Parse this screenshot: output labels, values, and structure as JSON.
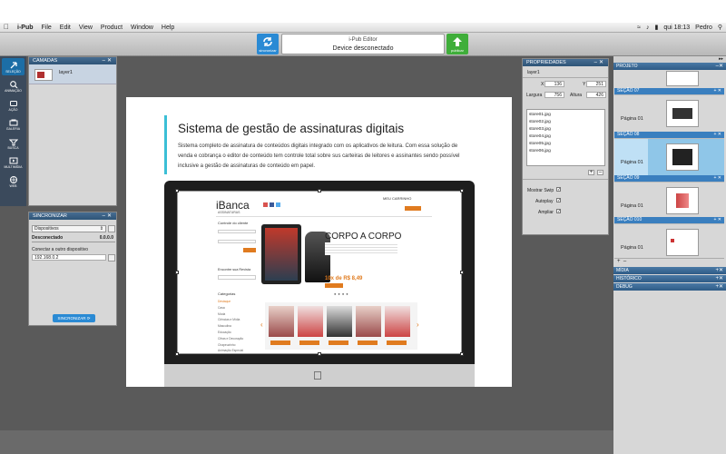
{
  "menubar": {
    "app_name": "i-Pub",
    "items": [
      "File",
      "Edit",
      "View",
      "Product",
      "Window",
      "Help"
    ],
    "clock": "qui 18:13",
    "user": "Pedro"
  },
  "toolbar": {
    "sync_label": "sincronizar",
    "publish_label": "publicar",
    "editor_title": "i-Pub Editor",
    "device_status": "Device desconectado"
  },
  "tools": [
    {
      "label": "seleção",
      "icon": "select-arrow-icon"
    },
    {
      "label": "animação",
      "icon": "zoom-icon"
    },
    {
      "label": "ação",
      "icon": "action-icon"
    },
    {
      "label": "galeria",
      "icon": "gallery-icon"
    },
    {
      "label": "busca",
      "icon": "search-icon"
    },
    {
      "label": "multimídia",
      "icon": "multimedia-icon"
    },
    {
      "label": "web",
      "icon": "web-icon"
    }
  ],
  "layers": {
    "title": "CAMADAS",
    "items": [
      "layer1"
    ]
  },
  "sync": {
    "title": "SINCRONIZAR",
    "select_value": "Dispositivos",
    "status_label": "Desconectado",
    "status_value": "0.0.0.0",
    "connect_label": "Conectar a outro dispositivo",
    "ip_value": "192.168.0.2",
    "button": "SINCRONIZAR"
  },
  "document": {
    "title": "Sistema de gestão de assinaturas digitais",
    "body": "Sistema completo de assinatura de conteúdos digitais integrado com os aplicativos de leitura. Com essa solução de venda e cobrança o editor de conteúdo tem controle total sobre sus carteiras de leitores e assinantes sendo possível inclusive a gestão de assinaturas de conteúdo em papel."
  },
  "website": {
    "brand": "iBanca",
    "brand_sub": "ASSINATURAS",
    "cart": "MEU CARRINHO",
    "headline": "CORPO A CORPO",
    "price": "10x de R$ 8,49",
    "side_title": "Controle do cliente",
    "side_search": "Encontre sua Revista",
    "categories_title": "Categorias",
    "categories": [
      "Destaque",
      "Casa",
      "Moda",
      "Ciências e Mídia",
      "Masculina",
      "Educação",
      "Cifras e Decoração",
      "Chapeuzinho",
      "Animação Especial"
    ]
  },
  "properties": {
    "title": "PROPRIEDADES",
    "layer": "layer1",
    "x_label": "X",
    "x_value": "136",
    "y_label": "Y",
    "y_value": "251",
    "width_label": "Largura",
    "width_value": "756",
    "height_label": "Altura",
    "height_value": "426",
    "files": [
      "store01.jpg",
      "store02.jpg",
      "store03.jpg",
      "store04.jpg",
      "store05.jpg",
      "store06.jpg"
    ],
    "options": [
      {
        "label": "Mostrar Swip",
        "checked": true
      },
      {
        "label": "Autoplay",
        "checked": true
      },
      {
        "label": "Ampliar",
        "checked": true
      }
    ]
  },
  "project": {
    "title": "PROJETO",
    "sections": [
      {
        "name": "",
        "page": "Página 01",
        "selected": false
      },
      {
        "name": "SEÇÃO 07",
        "page": "Página 01",
        "selected": false
      },
      {
        "name": "SEÇÃO 08",
        "page": "Página 01",
        "selected": true
      },
      {
        "name": "SEÇÃO 09",
        "page": "Página 01",
        "selected": false
      },
      {
        "name": "SEÇÃO 010",
        "page": "Página 01",
        "selected": false
      }
    ],
    "bars": [
      "MÍDIA",
      "HISTÓRICO",
      "DEBUG"
    ]
  },
  "colors": {
    "accent": "#3bbfd6",
    "panel_header": "#2e5477",
    "selected_row": "#8fc6e8",
    "sync_button": "#2a8ad4",
    "publish_button": "#3fae3a",
    "price": "#e07b1f"
  }
}
